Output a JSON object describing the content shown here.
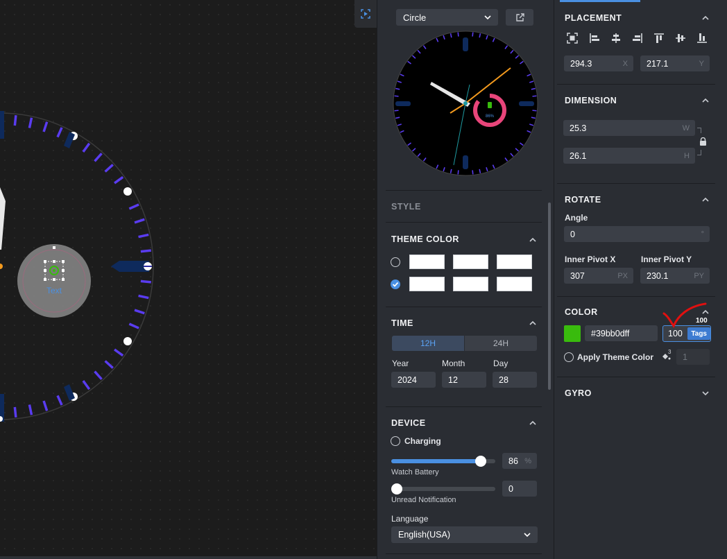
{
  "canvas": {
    "widget_label": "Text"
  },
  "preview": {
    "shape": "Circle",
    "battery_text": "86%"
  },
  "middle": {
    "style_title": "STYLE",
    "theme_color": {
      "title": "THEME COLOR",
      "rows": [
        [
          "#ffffff",
          "#ffffff",
          "#ffffff"
        ],
        [
          "#ffffff",
          "#ffffff",
          "#ffffff"
        ]
      ],
      "selected_row": 2
    },
    "time": {
      "title": "TIME",
      "mode_12": "12H",
      "mode_24": "24H",
      "year_label": "Year",
      "month_label": "Month",
      "day_label": "Day",
      "year": "2024",
      "month": "12",
      "day": "28"
    },
    "device": {
      "title": "DEVICE",
      "charging_label": "Charging",
      "battery_value": "86",
      "battery_unit": "%",
      "battery_fraction": 0.86,
      "battery_label": "Watch Battery",
      "notification_value": "0",
      "notification_fraction": 0,
      "notification_label": "Unread Notification",
      "language_label": "Language",
      "language": "English(USA)"
    }
  },
  "right": {
    "placement": {
      "title": "PLACEMENT",
      "x": "294.3",
      "x_unit": "X",
      "y": "217.1",
      "y_unit": "Y"
    },
    "dimension": {
      "title": "DIMENSION",
      "w": "25.3",
      "w_unit": "W",
      "h": "26.1",
      "h_unit": "H"
    },
    "rotate": {
      "title": "ROTATE",
      "angle_label": "Angle",
      "angle": "0",
      "angle_unit": "°",
      "pivot_x_label": "Inner Pivot X",
      "pivot_x": "307",
      "pivot_x_unit": "PX",
      "pivot_y_label": "Inner Pivot Y",
      "pivot_y": "230.1",
      "pivot_y_unit": "PY"
    },
    "color": {
      "title": "COLOR",
      "swatch": "#39bb0d",
      "hex": "#39bb0dff",
      "alpha": "100",
      "alpha_tooltip": "100",
      "tags_label": "Tags",
      "apply_theme_label": "Apply Theme Color",
      "theme_index": "1",
      "theme_index_sup": "3"
    },
    "gyro": {
      "title": "GYRO"
    }
  },
  "colors": {
    "accent": "#4a90e2",
    "panel": "#2a2d33",
    "field": "#3b3f47",
    "tick_purple": "#5a3cf0",
    "ring_pink": "#e8457a",
    "hand_orange": "#f39a1e"
  }
}
